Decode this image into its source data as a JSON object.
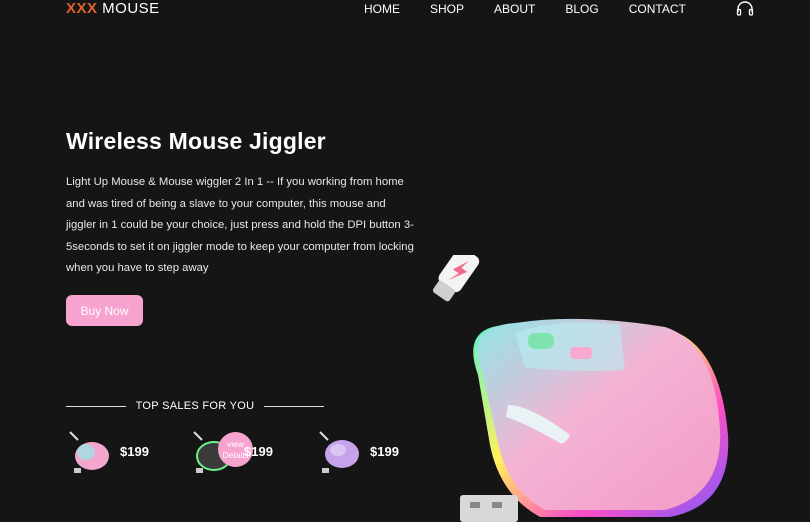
{
  "brand": {
    "accent": "XXX",
    "name": " MOUSE",
    "accent_color": "#e0622a"
  },
  "nav": [
    {
      "label": "HOME"
    },
    {
      "label": "SHOP"
    },
    {
      "label": "ABOUT"
    },
    {
      "label": "BLOG"
    },
    {
      "label": "CONTACT"
    }
  ],
  "header": {
    "icon": "headphones-icon"
  },
  "hero": {
    "title": "Wireless Mouse Jiggler",
    "description": "Light Up Mouse & Mouse wiggler 2 In 1 -- If you working from home and was tired of being a slave to your computer, this mouse and jiggler in 1 could be your choice, just press and hold the DPI button 3-5seconds to set it on jiggler mode to keep your computer from locking when you have to step away",
    "button_label": "Buy Now",
    "button_color": "#f6a3cf"
  },
  "top_sales": {
    "heading": "TOP SALES FOR YOU",
    "products": [
      {
        "price": "$199"
      },
      {
        "price": "$199",
        "badge": "view Details"
      },
      {
        "price": "$199"
      }
    ]
  }
}
